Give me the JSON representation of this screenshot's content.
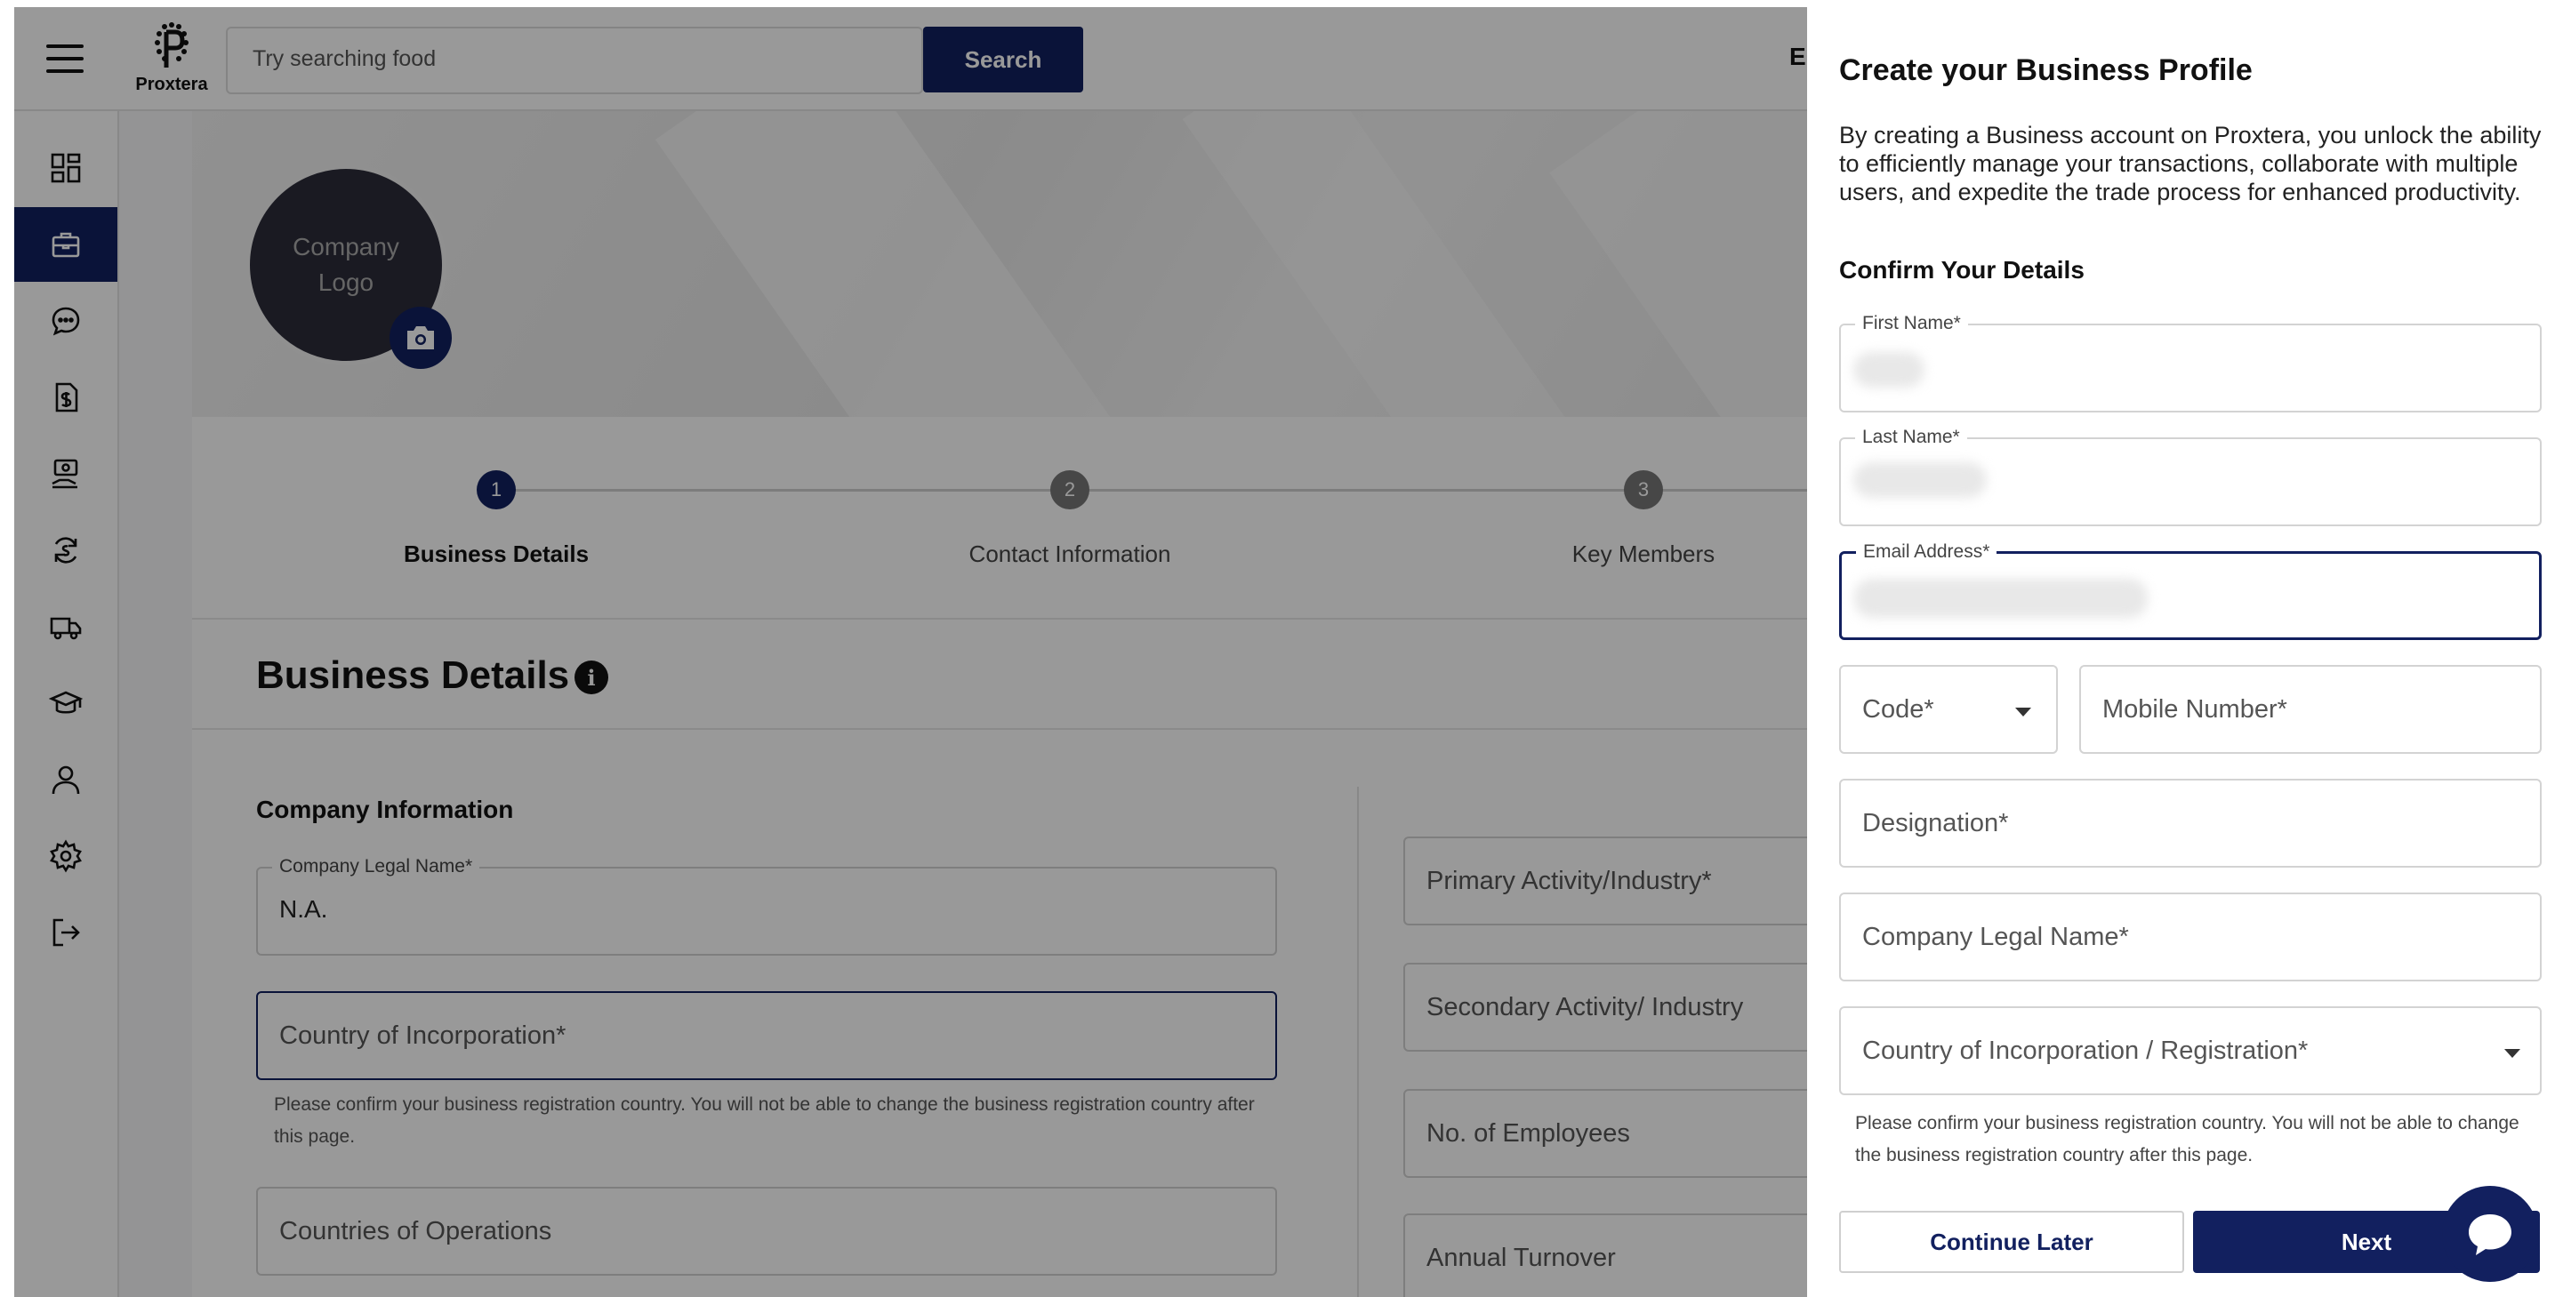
{
  "header": {
    "logo_text": "Proxtera",
    "search_placeholder": "Try searching food",
    "search_button": "Search",
    "truncated_text": "E"
  },
  "sidebar": {
    "items": [
      {
        "icon": "dashboard-icon",
        "active": false
      },
      {
        "icon": "briefcase-icon",
        "active": true
      },
      {
        "icon": "chat-icon",
        "active": false
      },
      {
        "icon": "document-dollar-icon",
        "active": false
      },
      {
        "icon": "payment-hand-icon",
        "active": false
      },
      {
        "icon": "currency-exchange-icon",
        "active": false
      },
      {
        "icon": "truck-icon",
        "active": false
      },
      {
        "icon": "graduation-cap-icon",
        "active": false
      },
      {
        "icon": "user-icon",
        "active": false
      },
      {
        "icon": "settings-icon",
        "active": false
      },
      {
        "icon": "logout-icon",
        "active": false
      }
    ]
  },
  "profile": {
    "logo_placeholder": "Company Logo"
  },
  "stepper": {
    "steps": [
      {
        "number": "1",
        "label": "Business Details",
        "active": true
      },
      {
        "number": "2",
        "label": "Contact Information",
        "active": false
      },
      {
        "number": "3",
        "label": "Key Members",
        "active": false
      }
    ]
  },
  "business_details": {
    "title": "Business Details",
    "section_title": "Company Information",
    "company_legal_name_label": "Company Legal Name*",
    "company_legal_name_value": "N.A.",
    "country_placeholder": "Country of Incorporation*",
    "country_helper": "Please confirm your business registration country. You will not be able to change the business registration country after this page.",
    "countries_of_operations_placeholder": "Countries of Operations",
    "primary_activity_placeholder": "Primary Activity/Industry*",
    "secondary_activity_placeholder": "Secondary Activity/ Industry",
    "employees_placeholder": "No. of Employees",
    "annual_turnover_placeholder": "Annual Turnover"
  },
  "panel": {
    "title": "Create your Business Profile",
    "description": "By creating a Business account on Proxtera, you unlock the ability to efficiently manage your transactions, collaborate with multiple users, and expedite the trade process for enhanced productivity.",
    "subtitle": "Confirm Your Details",
    "first_name_label": "First Name*",
    "last_name_label": "Last Name*",
    "email_label": "Email Address*",
    "code_placeholder": "Code*",
    "mobile_placeholder": "Mobile Number*",
    "designation_placeholder": "Designation*",
    "company_legal_name_placeholder": "Company Legal Name*",
    "country_placeholder": "Country of Incorporation / Registration*",
    "helper": "Please confirm your business registration country. You will not be able to change the business registration country after this page.",
    "continue_button": "Continue Later",
    "next_button": "Next"
  },
  "colors": {
    "brand": "#12205f",
    "overlay": "rgba(0,0,0,0.40)"
  }
}
